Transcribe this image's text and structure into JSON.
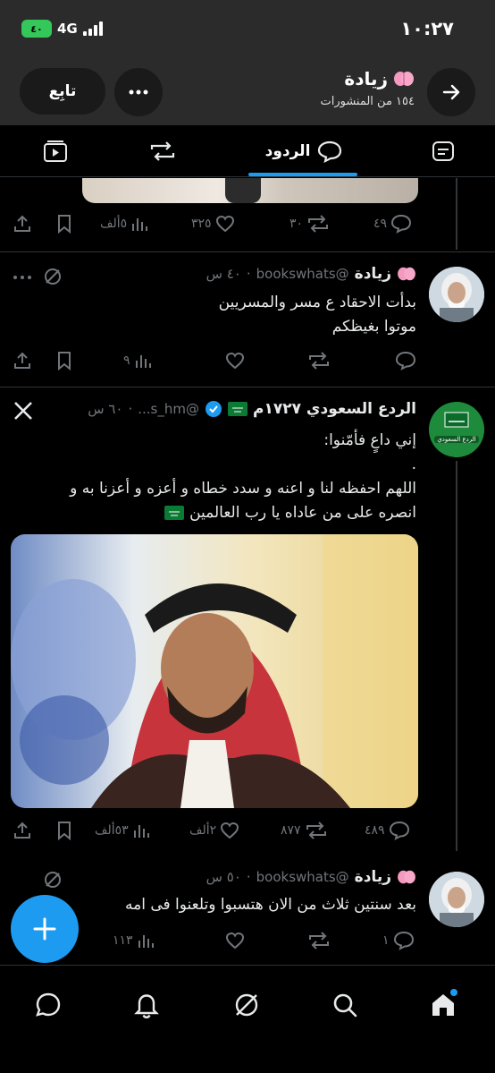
{
  "status_bar": {
    "time": "١٠:٢٧",
    "battery_label": "٤٠",
    "network": "4G"
  },
  "profile_header": {
    "name": "زيادة",
    "posts_count": "١٥٤ من المنشورات",
    "follow_label": "تابِع"
  },
  "tabs": {
    "active_label": "الردود"
  },
  "tweets": [
    {
      "metrics": {
        "replies": "٤٩",
        "reposts": "٣٠",
        "likes": "٣٢٥",
        "views": "٥ألف"
      }
    },
    {
      "name": "زيادة",
      "handle": "@bookswhats",
      "time": "٤٠ س",
      "text_line1": "بدأت الاحقاد ع مسر والمسريين",
      "text_line2": "موتوا بغيظكم",
      "metrics": {
        "replies": "",
        "reposts": "",
        "likes": "",
        "views": "٩"
      }
    },
    {
      "name": "الردع السعودي ١٧٢٧م",
      "handle": "@s_hm...",
      "time": "٦٠ س",
      "text_line1": "إني داعٍ فأمّنوا:",
      "text_line2": ".",
      "text_line3": "اللهم احفظه لنا و اعنه و سدد خطاه و أعزه و أعزنا به و",
      "text_line4": "انصره على من عاداه يا رب العالمين",
      "avatar_label": "الردع السعودي",
      "metrics": {
        "replies": "٤٨٩",
        "reposts": "٨٧٧",
        "likes": "٢ألف",
        "views": "٥٣ألف"
      }
    },
    {
      "name": "زيادة",
      "handle": "@bookswhats",
      "time": "٥٠ س",
      "text_line1": "بعد سنتين ثلاث من الان هتسبوا وتلعنوا فى امه",
      "metrics": {
        "replies": "١",
        "reposts": "",
        "likes": "",
        "views": "١١٣"
      }
    }
  ],
  "colors": {
    "accent": "#1d9bf0",
    "header_bg": "#2b2b2b",
    "battery": "#34c759",
    "muted": "#71767b"
  }
}
